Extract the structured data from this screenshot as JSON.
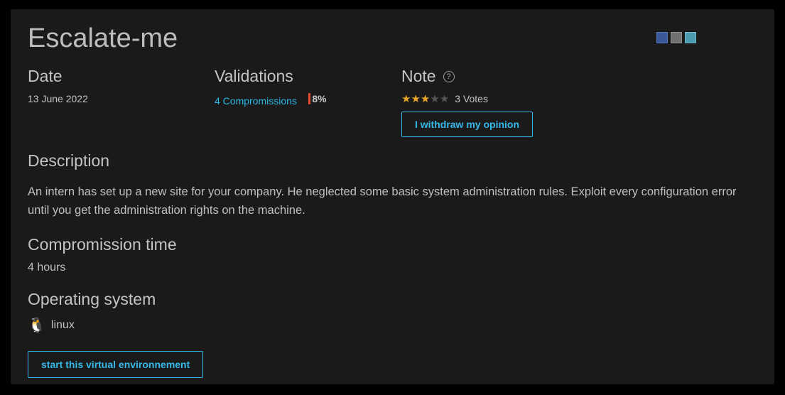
{
  "title": "Escalate-me",
  "meta": {
    "date_label": "Date",
    "date_value": "13 June 2022",
    "validations_label": "Validations",
    "compromissions_text": "4 Compromissions",
    "percent_text": "8%",
    "note_label": "Note",
    "stars_filled": 3,
    "stars_total": 5,
    "votes_text": "3 Votes",
    "withdraw_label": "I withdraw my opinion"
  },
  "description": {
    "heading": "Description",
    "text": "An intern has set up a new site for your company. He neglected some basic system administration rules. Exploit every configuration error until you get the administration rights on the machine."
  },
  "compromission_time": {
    "heading": "Compromission time",
    "value": "4 hours"
  },
  "os": {
    "heading": "Operating system",
    "value": "linux"
  },
  "start_button": "start this virtual environnement",
  "help_glyph": "?"
}
